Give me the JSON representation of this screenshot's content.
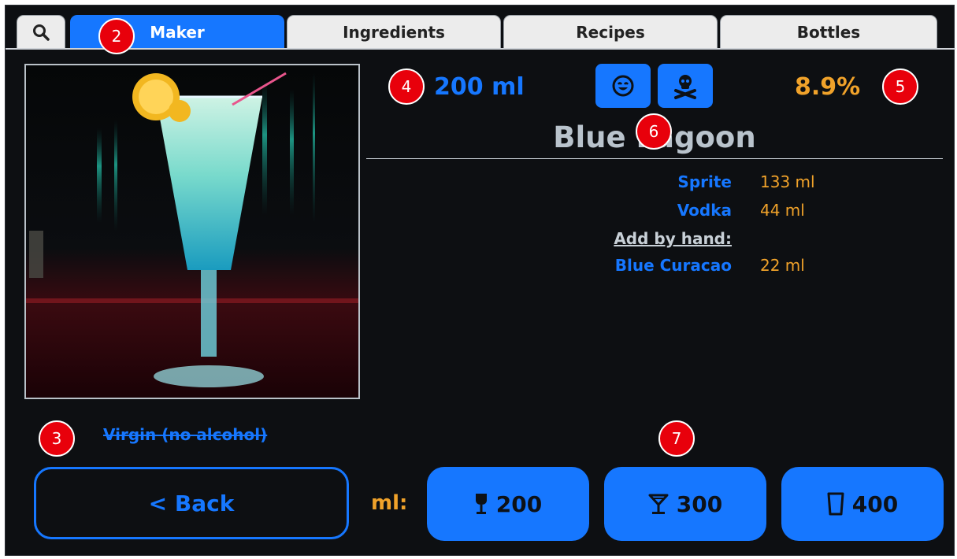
{
  "tabs": {
    "search_icon": "search-icon",
    "maker": "Maker",
    "ingredients": "Ingredients",
    "recipes": "Recipes",
    "bottles": "Bottles",
    "active": "Maker"
  },
  "drink": {
    "volume": "200 ml",
    "alcohol_percent": "8.9%",
    "name": "Blue Lagoon",
    "ingredients": [
      {
        "name": "Sprite",
        "amount": "133 ml"
      },
      {
        "name": "Vodka",
        "amount": "44 ml"
      }
    ],
    "add_by_hand_label": "Add by hand:",
    "by_hand": [
      {
        "name": "Blue Curacao",
        "amount": "22 ml"
      }
    ],
    "virgin_label": "Virgin (no alcohol)"
  },
  "buttons": {
    "back": "< Back",
    "ml_label": "ml:",
    "sizes": [
      {
        "label": "200",
        "icon": "wine-glass-icon"
      },
      {
        "label": "300",
        "icon": "cocktail-glass-icon"
      },
      {
        "label": "400",
        "icon": "tumbler-glass-icon"
      }
    ],
    "happy_icon": "smiley-icon",
    "poison_icon": "skull-crossbones-icon"
  },
  "markers": [
    "2",
    "3",
    "4",
    "5",
    "6",
    "7"
  ],
  "colors": {
    "accent": "#1677ff",
    "orange": "#f0a22a",
    "background": "#0d0f12",
    "marker": "#e8000b"
  }
}
